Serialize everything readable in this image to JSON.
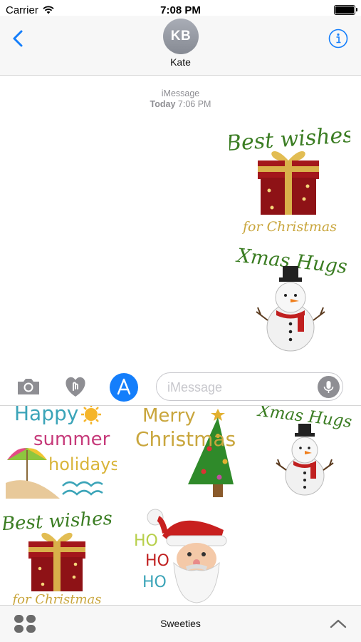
{
  "status_bar": {
    "carrier": "Carrier",
    "time": "7:08 PM",
    "battery_level": 1.0
  },
  "header": {
    "back_icon": "chevron-left-icon",
    "avatar_initials": "KB",
    "contact_name": "Kate",
    "info_icon": "info-icon"
  },
  "conversation": {
    "service": "iMessage",
    "date_label": "Today",
    "time_label": "7:06 PM",
    "sent_stickers": [
      {
        "line1": "Best wishes",
        "line2": "for Christmas",
        "icon": "gift-box-icon"
      },
      {
        "line1": "Xmas Hugs",
        "icon": "snowman-icon"
      }
    ]
  },
  "input_bar": {
    "camera_icon": "camera-icon",
    "digital_touch_icon": "heart-touch-icon",
    "app_store_icon": "app-store-icon",
    "placeholder": "iMessage",
    "mic_icon": "microphone-icon"
  },
  "drawer": {
    "stickers": [
      {
        "id": "summer",
        "lines": [
          "Happy",
          "summer",
          "holidays"
        ],
        "icon": "beach-umbrella-icon"
      },
      {
        "id": "merry",
        "lines": [
          "Merry",
          "Christmas"
        ],
        "icon": "christmas-tree-icon"
      },
      {
        "id": "xmas-hugs",
        "lines": [
          "Xmas Hugs"
        ],
        "icon": "snowman-icon"
      },
      {
        "id": "best-wishes",
        "lines": [
          "Best wishes",
          "for Christmas"
        ],
        "icon": "gift-box-icon"
      },
      {
        "id": "ho-ho-ho",
        "lines": [
          "HO",
          "HO",
          "HO"
        ],
        "icon": "santa-icon"
      }
    ]
  },
  "bottom_bar": {
    "apps_icon": "app-grid-icon",
    "app_name": "Sweeties",
    "expand_icon": "chevron-up-icon"
  },
  "colors": {
    "ios_blue": "#147efb",
    "green_text": "#3b7d23",
    "gold_text": "#c9a63d",
    "red": "#b81d1d"
  }
}
